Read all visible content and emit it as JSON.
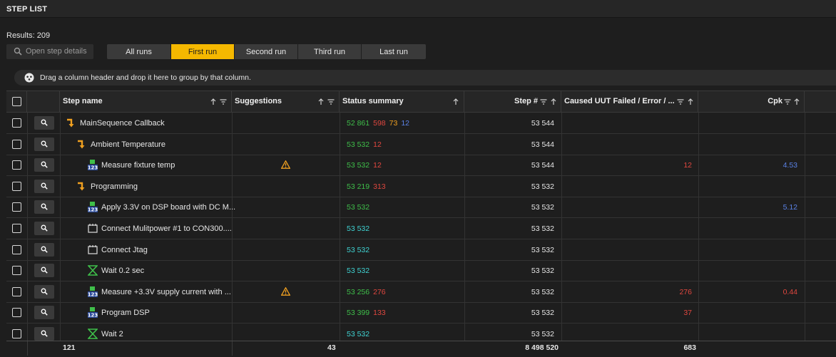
{
  "panel": {
    "title": "STEP LIST"
  },
  "results_label": "Results: 209",
  "open_details_label": "Open step details",
  "runs": [
    {
      "label": "All runs",
      "active": false
    },
    {
      "label": "First run",
      "active": true
    },
    {
      "label": "Second run",
      "active": false
    },
    {
      "label": "Third run",
      "active": false
    },
    {
      "label": "Last run",
      "active": false
    }
  ],
  "group_hint": "Drag a column header and drop it here to group by that column.",
  "columns": {
    "step_name": "Step name",
    "suggestions": "Suggestions",
    "status_summary": "Status summary",
    "step_num": "Step #",
    "caused": "Caused UUT Failed / Error / ...",
    "cpk": "Cpk"
  },
  "colors": {
    "accent": "#f5b800",
    "passed": "#3fbf4a",
    "failed": "#e0473f",
    "error": "#f0a020",
    "terminated": "#5a82e6",
    "done": "#3fd3d3"
  },
  "rows": [
    {
      "icon": "sequence-call-icon",
      "level": 0,
      "name": "MainSequence Callback",
      "warning": false,
      "status": [
        [
          "52 861",
          "g"
        ],
        [
          "598",
          "r"
        ],
        [
          "73",
          "o"
        ],
        [
          "12",
          "b"
        ]
      ],
      "step_num": "53 544",
      "caused": "",
      "cpk": "",
      "cpk_color": ""
    },
    {
      "icon": "sequence-call-icon",
      "level": 1,
      "name": "Ambient Temperature",
      "warning": false,
      "status": [
        [
          "53 532",
          "g"
        ],
        [
          "12",
          "r"
        ]
      ],
      "step_num": "53 544",
      "caused": "",
      "cpk": "",
      "cpk_color": ""
    },
    {
      "icon": "numeric-test-icon",
      "level": 2,
      "name": "Measure fixture temp",
      "warning": true,
      "status": [
        [
          "53 532",
          "g"
        ],
        [
          "12",
          "r"
        ]
      ],
      "step_num": "53 544",
      "caused": "12",
      "cpk": "4.53",
      "cpk_color": "b"
    },
    {
      "icon": "sequence-call-icon",
      "level": 1,
      "name": "Programming",
      "warning": false,
      "status": [
        [
          "53 219",
          "g"
        ],
        [
          "313",
          "r"
        ]
      ],
      "step_num": "53 532",
      "caused": "",
      "cpk": "",
      "cpk_color": ""
    },
    {
      "icon": "numeric-test-icon",
      "level": 2,
      "name": "Apply 3.3V on DSP board with DC M...",
      "warning": false,
      "status": [
        [
          "53 532",
          "g"
        ]
      ],
      "step_num": "53 532",
      "caused": "",
      "cpk": "5.12",
      "cpk_color": "b"
    },
    {
      "icon": "action-icon",
      "level": 2,
      "name": "Connect Mulitpower #1 to CON300....",
      "warning": false,
      "status": [
        [
          "53 532",
          "c"
        ]
      ],
      "step_num": "53 532",
      "caused": "",
      "cpk": "",
      "cpk_color": ""
    },
    {
      "icon": "action-icon",
      "level": 2,
      "name": "Connect Jtag",
      "warning": false,
      "status": [
        [
          "53 532",
          "c"
        ]
      ],
      "step_num": "53 532",
      "caused": "",
      "cpk": "",
      "cpk_color": ""
    },
    {
      "icon": "wait-icon",
      "level": 2,
      "name": "Wait 0.2 sec",
      "warning": false,
      "status": [
        [
          "53 532",
          "c"
        ]
      ],
      "step_num": "53 532",
      "caused": "",
      "cpk": "",
      "cpk_color": ""
    },
    {
      "icon": "numeric-test-icon",
      "level": 2,
      "name": "Measure +3.3V supply current with ...",
      "warning": true,
      "status": [
        [
          "53 256",
          "g"
        ],
        [
          "276",
          "r"
        ]
      ],
      "step_num": "53 532",
      "caused": "276",
      "cpk": "0.44",
      "cpk_color": "r"
    },
    {
      "icon": "numeric-test-icon",
      "level": 2,
      "name": "Program DSP",
      "warning": false,
      "status": [
        [
          "53 399",
          "g"
        ],
        [
          "133",
          "r"
        ]
      ],
      "step_num": "53 532",
      "caused": "37",
      "cpk": "",
      "cpk_color": ""
    },
    {
      "icon": "wait-icon",
      "level": 2,
      "name": "Wait 2",
      "warning": false,
      "status": [
        [
          "53 532",
          "c"
        ]
      ],
      "step_num": "53 532",
      "caused": "",
      "cpk": "",
      "cpk_color": ""
    }
  ],
  "footer": {
    "step_name_count": "121",
    "suggestions_count": "43",
    "step_num_sum": "8 498 520",
    "caused_sum": "683"
  }
}
